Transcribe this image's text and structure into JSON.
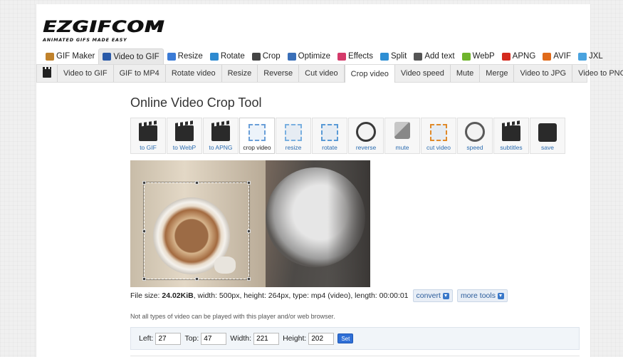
{
  "logo": {
    "main": "EZGIFCOM",
    "tagline": "ANIMATED GIFS MADE EASY"
  },
  "main_nav": [
    {
      "label": "GIF Maker",
      "icon": "gif-maker-icon",
      "color": "#c0822c"
    },
    {
      "label": "Video to GIF",
      "icon": "film-icon",
      "color": "#2a5aa8",
      "active": true
    },
    {
      "label": "Resize",
      "icon": "resize-icon",
      "color": "#3b7bd6"
    },
    {
      "label": "Rotate",
      "icon": "rotate-icon",
      "color": "#2e8ad0"
    },
    {
      "label": "Crop",
      "icon": "crop-icon",
      "color": "#444444"
    },
    {
      "label": "Optimize",
      "icon": "optimize-icon",
      "color": "#3a6fb8"
    },
    {
      "label": "Effects",
      "icon": "effects-icon",
      "color": "#d43a6a"
    },
    {
      "label": "Split",
      "icon": "split-icon",
      "color": "#2f8fd4"
    },
    {
      "label": "Add text",
      "icon": "add-text-icon",
      "color": "#555555"
    },
    {
      "label": "WebP",
      "icon": "webp-icon",
      "color": "#6fb42c"
    },
    {
      "label": "APNG",
      "icon": "apng-icon",
      "color": "#d42a1e"
    },
    {
      "label": "AVIF",
      "icon": "avif-icon",
      "color": "#e06a1a"
    },
    {
      "label": "JXL",
      "icon": "jxl-icon",
      "color": "#4aa3df"
    }
  ],
  "sub_nav": [
    "Video to GIF",
    "GIF to MP4",
    "Rotate video",
    "Resize",
    "Reverse",
    "Cut video",
    "Crop video",
    "Video speed",
    "Mute",
    "Merge",
    "Video to JPG",
    "Video to PNG"
  ],
  "sub_nav_active": "Crop video",
  "page_title": "Online Video Crop Tool",
  "tools": [
    {
      "label": "to GIF",
      "icon": "clapper-gif-icon"
    },
    {
      "label": "to WebP",
      "icon": "clapper-webp-icon"
    },
    {
      "label": "to APNG",
      "icon": "clapper-apng-icon"
    },
    {
      "label": "crop video",
      "icon": "crop-video-icon",
      "active": true
    },
    {
      "label": "resize",
      "icon": "resize-video-icon"
    },
    {
      "label": "rotate",
      "icon": "rotate-video-icon"
    },
    {
      "label": "reverse",
      "icon": "reverse-icon"
    },
    {
      "label": "mute",
      "icon": "mute-icon"
    },
    {
      "label": "cut video",
      "icon": "scissors-icon"
    },
    {
      "label": "speed",
      "icon": "speed-icon"
    },
    {
      "label": "subtitles",
      "icon": "subtitles-icon"
    },
    {
      "label": "save",
      "icon": "floppy-disk-icon"
    }
  ],
  "file_info": {
    "prefix": "File size:",
    "size": "24.02KiB",
    "rest": ", width: 500px, height: 264px, type: mp4 (video), length: 00:00:01",
    "convert_label": "convert",
    "more_tools_label": "more tools"
  },
  "note": "Not all types of video can be played with this player and/or web browser.",
  "crop_form": {
    "left_label": "Left:",
    "left_value": "27",
    "top_label": "Top:",
    "top_value": "47",
    "width_label": "Width:",
    "width_value": "221",
    "height_label": "Height:",
    "height_value": "202",
    "set_label": "Set"
  },
  "colors": {
    "link": "#2b6cb0",
    "set_button": "#2f6fd6"
  }
}
